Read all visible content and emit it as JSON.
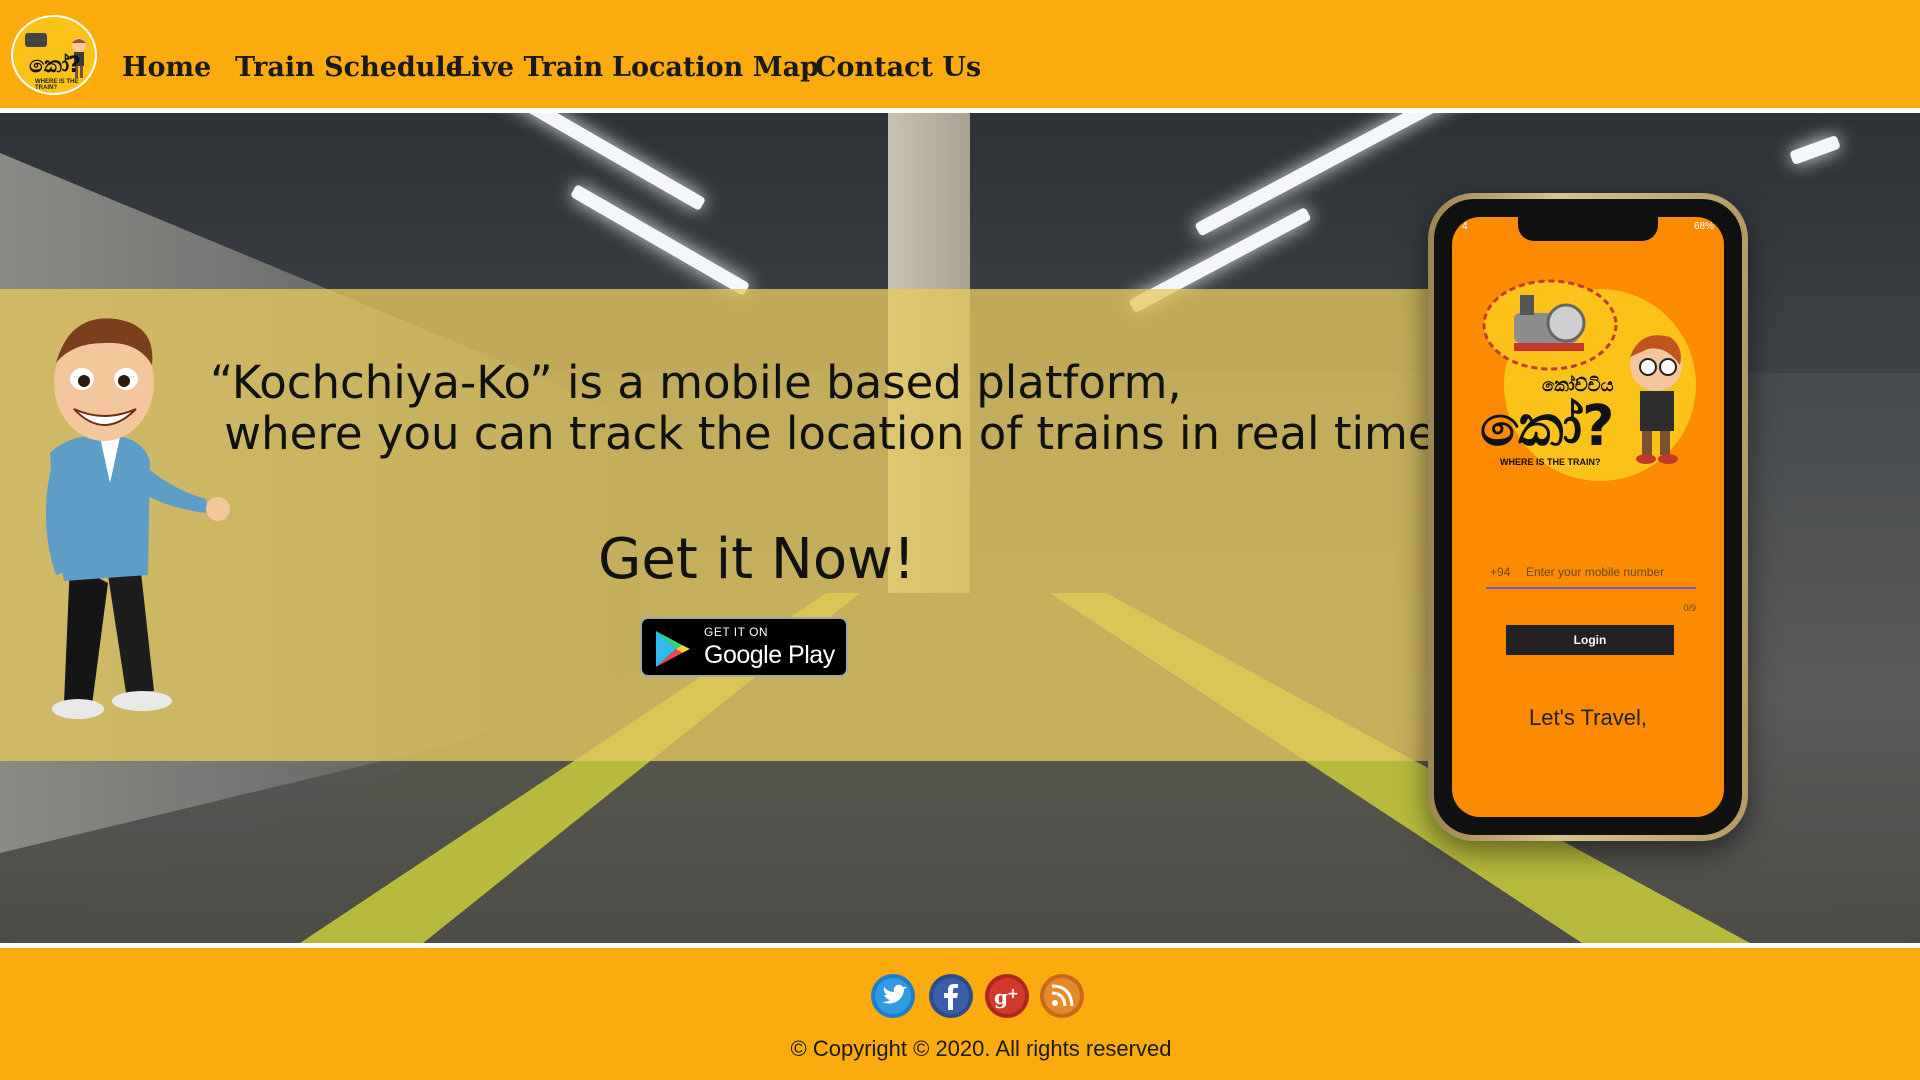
{
  "header": {
    "logo_text": "කෝ?",
    "logo_sub": "WHERE IS THE TRAIN?",
    "nav": [
      "Home",
      "Train Schedule",
      "Live Train",
      "Location Map",
      "Contact Us"
    ]
  },
  "hero": {
    "tagline": "“Kochchiya-Ko” is a mobile based platform,\n where you can track the location of trains in real time.",
    "cta": "Get it Now!",
    "badge": {
      "small": "GET IT ON",
      "big": "Google Play"
    }
  },
  "phone": {
    "status_left": "4",
    "status_right": "68%",
    "app_title": "කෝච්චිය",
    "app_logo_text": "කෝ?",
    "app_tagline": "WHERE IS THE TRAIN?",
    "country_code": "+94",
    "input_placeholder": "Enter your mobile number",
    "char_count": "0/9",
    "login_label": "Login",
    "lets_travel": "Let's Travel,"
  },
  "footer": {
    "social": [
      "twitter-icon",
      "facebook-icon",
      "google-plus-icon",
      "rss-icon"
    ],
    "copyright": "© Copyright © 2020. All rights reserved"
  },
  "colors": {
    "brand_orange": "#fbab0e",
    "overlay_yellow": "#e6c85f",
    "phone_screen": "#fc8b02"
  }
}
